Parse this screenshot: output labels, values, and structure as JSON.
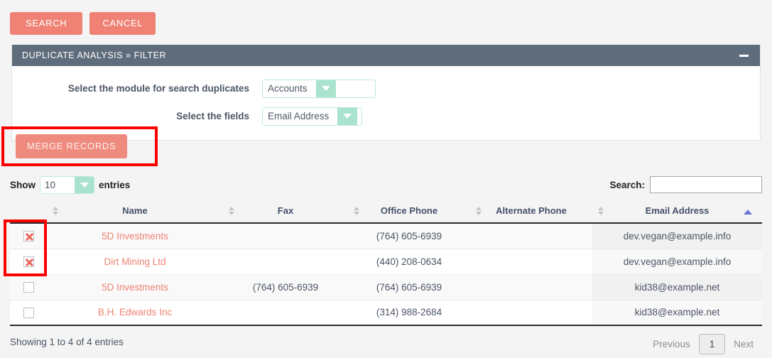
{
  "toolbar": {
    "search_label": "SEARCH",
    "cancel_label": "CANCEL"
  },
  "panel": {
    "title": "DUPLICATE ANALYSIS » FILTER",
    "collapse_icon": "minus-icon",
    "fields": [
      {
        "label": "Select the module for search duplicates",
        "value": "Accounts"
      },
      {
        "label": "Select the fields",
        "value": "Email Address"
      }
    ]
  },
  "actions": {
    "merge_label": "MERGE RECORDS"
  },
  "annotations": {
    "color": "#fc0000",
    "boxes": [
      "merge-records-button",
      "selected-row-checkboxes"
    ]
  },
  "datatable": {
    "length": {
      "prefix": "Show",
      "value": "10",
      "suffix": "entries"
    },
    "filter": {
      "label": "Search:",
      "value": "",
      "placeholder": ""
    },
    "columns": [
      {
        "key": "check",
        "label": "",
        "sortable": false,
        "sort": "none"
      },
      {
        "key": "name",
        "label": "Name",
        "sortable": true,
        "sort": "none"
      },
      {
        "key": "fax",
        "label": "Fax",
        "sortable": true,
        "sort": "none"
      },
      {
        "key": "office",
        "label": "Office Phone",
        "sortable": true,
        "sort": "none"
      },
      {
        "key": "alt",
        "label": "Alternate Phone",
        "sortable": true,
        "sort": "none"
      },
      {
        "key": "email",
        "label": "Email Address",
        "sortable": true,
        "sort": "asc"
      }
    ],
    "rows": [
      {
        "checked": true,
        "name": "5D Investments",
        "fax": "",
        "office": "(764) 605-6939",
        "alt": "",
        "email": "dev.vegan@example.info"
      },
      {
        "checked": true,
        "name": "Dirt Mining Ltd",
        "fax": "",
        "office": "(440) 208-0634",
        "alt": "",
        "email": "dev.vegan@example.info"
      },
      {
        "checked": false,
        "name": "5D Investments",
        "fax": "(764) 605-6939",
        "office": "(764) 605-6939",
        "alt": "",
        "email": "kid38@example.net"
      },
      {
        "checked": false,
        "name": "B.H. Edwards Inc",
        "fax": "",
        "office": "(314) 988-2684",
        "alt": "",
        "email": "kid38@example.net"
      }
    ],
    "info": "Showing 1 to 4 of 4 entries",
    "paginate": {
      "previous": "Previous",
      "current": "1",
      "next": "Next"
    }
  },
  "colors": {
    "coral": "#ef8275",
    "panel_header": "#5f6c7b",
    "select_accent": "#a9e3cd",
    "sort_active": "#6f76d6",
    "annotation": "#fc0000"
  }
}
